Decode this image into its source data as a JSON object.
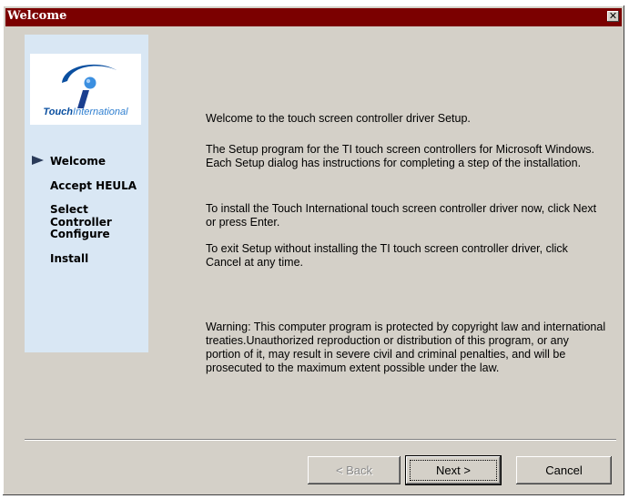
{
  "window": {
    "title": "Welcome",
    "close_glyph": "✕"
  },
  "logo": {
    "brand_strong": "Touch",
    "brand_light": "International"
  },
  "steps": [
    {
      "label": "Welcome",
      "current": true
    },
    {
      "label": "Accept HEULA",
      "current": false
    },
    {
      "label": "Select Controller",
      "current": false
    },
    {
      "label": "Configure",
      "current": false
    },
    {
      "label": "Install",
      "current": false
    }
  ],
  "content": {
    "intro": "Welcome to the touch screen controller driver Setup.",
    "para1": "The Setup program for the TI touch screen controllers for Microsoft Windows.  Each Setup dialog has instructions for completing a step of the installation.",
    "para2": "To install the Touch International touch screen controller driver now, click Next or press Enter.",
    "para3": "To exit Setup without installing the TI touch screen controller driver, click Cancel at any time.",
    "warning": "Warning: This computer program is protected by copyright law and international treaties.Unauthorized reproduction or distribution of this program, or any portion of it, may result in severe civil and criminal penalties, and will be prosecuted to the maximum extent possible under the law."
  },
  "buttons": {
    "back": "< Back",
    "next": "Next >",
    "cancel": "Cancel"
  },
  "colors": {
    "title_bar": "#7b0000",
    "sidebar": "#d9e7f4",
    "logo_blue": "#0a4fa0"
  }
}
